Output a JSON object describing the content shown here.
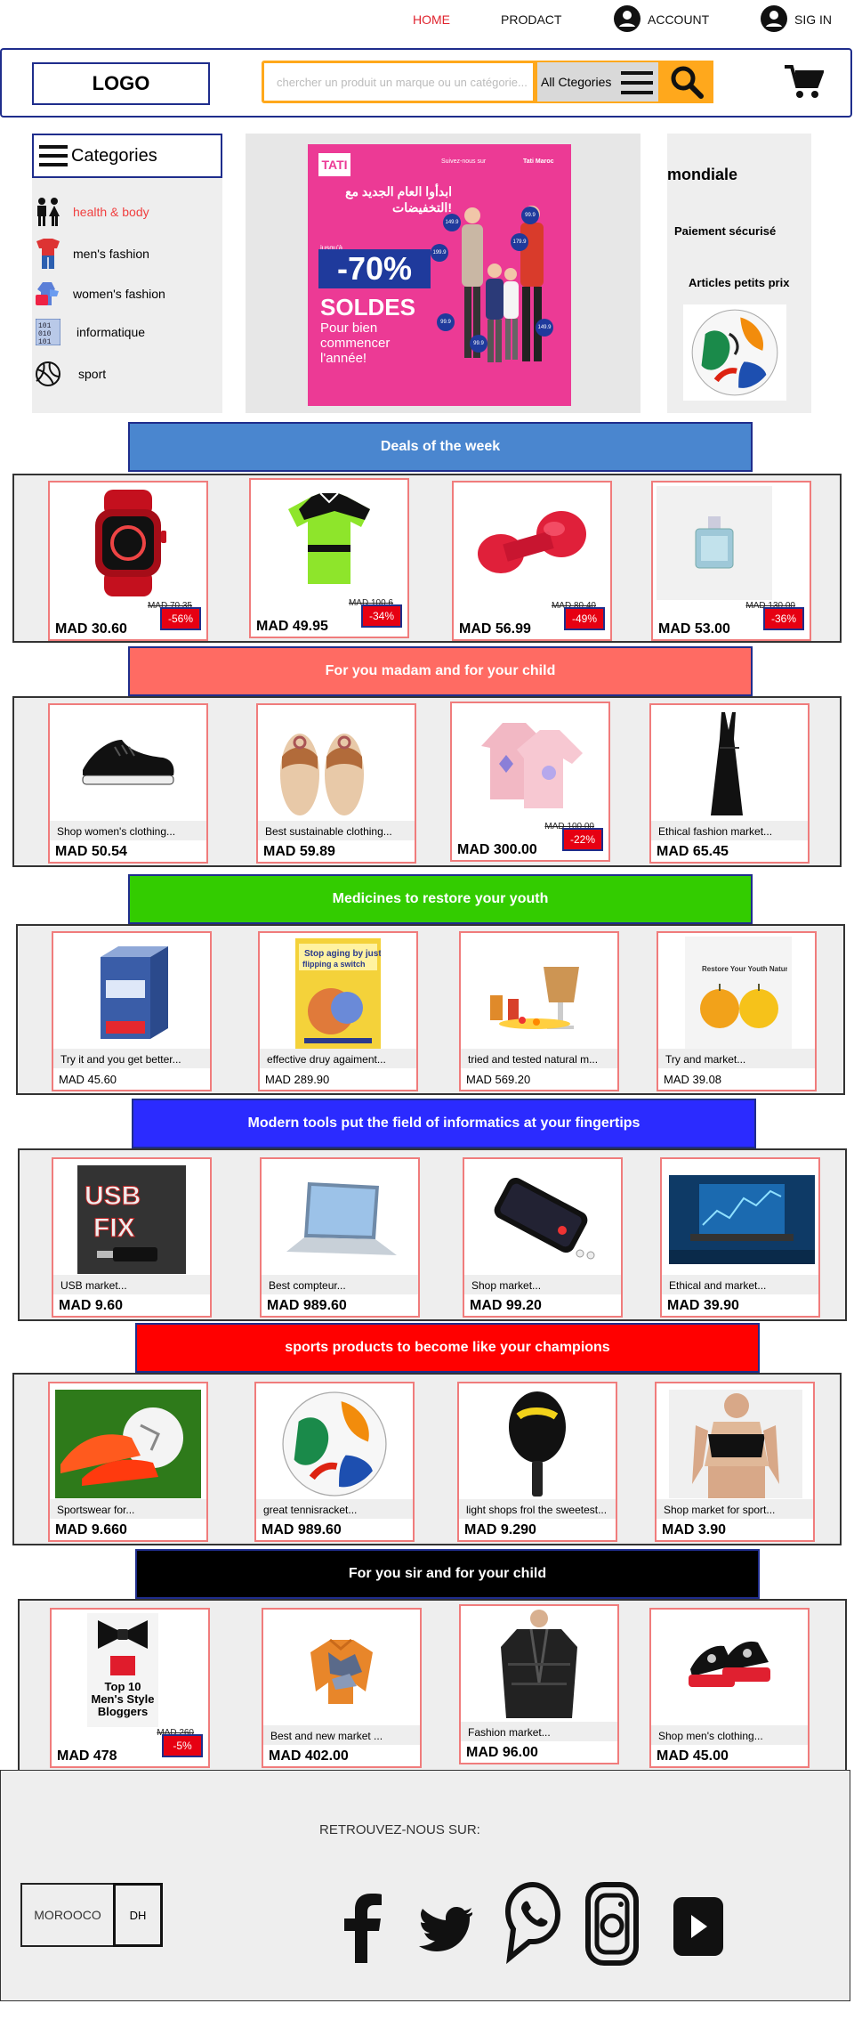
{
  "nav": {
    "home": "HOME",
    "product": "PRODACT",
    "account": "ACCOUNT",
    "signin": "SIG IN"
  },
  "header": {
    "logo": "LOGO",
    "search_placeholder": "chercher un produit un marque ou un catégorie...",
    "category_select": "All Ctegories"
  },
  "categories": {
    "title": "Categories",
    "items": [
      {
        "label": "health & body",
        "icon": "people-icon",
        "active": true
      },
      {
        "label": "men's fashion",
        "icon": "mens-clothes-icon",
        "active": false
      },
      {
        "label": "women's fashion",
        "icon": "womens-clothes-icon",
        "active": false
      },
      {
        "label": "informatique",
        "icon": "binary-icon",
        "active": false
      },
      {
        "label": "sport",
        "icon": "ball-icon",
        "active": false
      }
    ]
  },
  "banner": {
    "brand": "TATI",
    "top_text": "Suivez-nous sur",
    "brand_name": "Tati Maroc",
    "arabic": "ابدأوا العام الجديد مع التخفيضات!",
    "upto": "jusqu'à",
    "discount": "-70%",
    "soldes": "SOLDES",
    "sub": "Pour bien commencer l'année!",
    "price_tags": [
      "149.9",
      "99.9",
      "179.9",
      "199.9",
      "99.9",
      "99.9",
      "149.9"
    ]
  },
  "side": {
    "line1": "mondiale",
    "line2": "Paiement sécurisé",
    "line3": "Articles petits prix"
  },
  "sections": [
    {
      "title": "Deals of the week",
      "color": "#4a86cf",
      "cards": [
        {
          "image": "red-smartwatch",
          "old": "MAD 70.35",
          "price": "MAD 30.60",
          "discount": "-56%"
        },
        {
          "image": "green-sport-shirt",
          "old": "MAD 100.6",
          "price": "MAD 49.95",
          "discount": "-34%"
        },
        {
          "image": "red-dumbbell",
          "old": "MAD 80.40",
          "price": "MAD 56.99",
          "discount": "-49%"
        },
        {
          "image": "perfume-bottle",
          "old": "MAD 130.00",
          "price": "MAD 53.00",
          "discount": "-36%"
        }
      ]
    },
    {
      "title": "For you madam and for your child",
      "color": "#ff6b63",
      "cards": [
        {
          "image": "black-sneaker",
          "desc": "Shop women's clothing...",
          "price": "MAD 50.54"
        },
        {
          "image": "sandals",
          "desc": "Best sustainable clothing...",
          "price": "MAD 59.89"
        },
        {
          "image": "pink-sweatshirts",
          "old": "MAD 100.00",
          "price": "MAD 300.00",
          "discount": "-22%"
        },
        {
          "image": "black-dress",
          "desc": "Ethical fashion market...",
          "price": "MAD 65.45"
        }
      ]
    },
    {
      "title": "Medicines to restore your youth",
      "color": "#33cc00",
      "cards": [
        {
          "image": "supplement-box",
          "desc": "Try it and you get better...",
          "price": "MAD  45.60"
        },
        {
          "image": "anti-aging-book",
          "desc": "effective druy agaiment...",
          "price": "MAD  289.90"
        },
        {
          "image": "natural-medicine",
          "desc": "tried and tested natural m...",
          "price": "MAD  569.20"
        },
        {
          "image": "apples-youth",
          "desc": "Try and market...",
          "price": "MAD  39.08"
        }
      ]
    },
    {
      "title": "Modern tools put the field of informatics at your fingertips",
      "color": "#2b2bff",
      "cards": [
        {
          "image": "usb-fix",
          "desc": "USB market...",
          "price": "MAD  9.60"
        },
        {
          "image": "laptop",
          "desc": "Best compteur...",
          "price": "MAD  989.60"
        },
        {
          "image": "smartphone",
          "desc": "Shop market...",
          "price": "MAD  99.20"
        },
        {
          "image": "trading-laptop",
          "desc": "Ethical and market...",
          "price": "MAD  39.90"
        }
      ]
    },
    {
      "title": "sports products to become like your champions",
      "color": "#ff0000",
      "cards": [
        {
          "image": "football-boots",
          "desc": "Sportswear for...",
          "price": "MAD  9.660"
        },
        {
          "image": "soccer-ball",
          "desc": "great tennisracket...",
          "price": "MAD  989.60"
        },
        {
          "image": "paddle-racket",
          "desc": "light shops frol the sweetest...",
          "price": "MAD  9.290"
        },
        {
          "image": "sports-bra",
          "desc": "Shop market for sport...",
          "price": "MAD  3.90"
        }
      ]
    },
    {
      "title": "For  you  sir and for your child",
      "color": "#000000",
      "cards": [
        {
          "image": "bowtie-book",
          "old": "MAD 260",
          "price": "MAD 478",
          "discount": "-5%",
          "book_text": "Top 10 Men's Style Bloggers"
        },
        {
          "image": "orange-sweater",
          "desc": "Best and new market ...",
          "price": "MAD 402.00"
        },
        {
          "image": "leather-jacket",
          "desc": "Fashion market...",
          "price": "MAD  96.00"
        },
        {
          "image": "platform-shoes",
          "desc": "Shop men's clothing...",
          "price": "MAD 45.00"
        }
      ]
    }
  ],
  "footer": {
    "follow": "RETROUVEZ-NOUS SUR:",
    "country": "MOROOCO",
    "currency": "DH",
    "social": [
      "facebook-icon",
      "twitter-icon",
      "whatsapp-icon",
      "instagram-icon",
      "youtube-icon"
    ]
  }
}
